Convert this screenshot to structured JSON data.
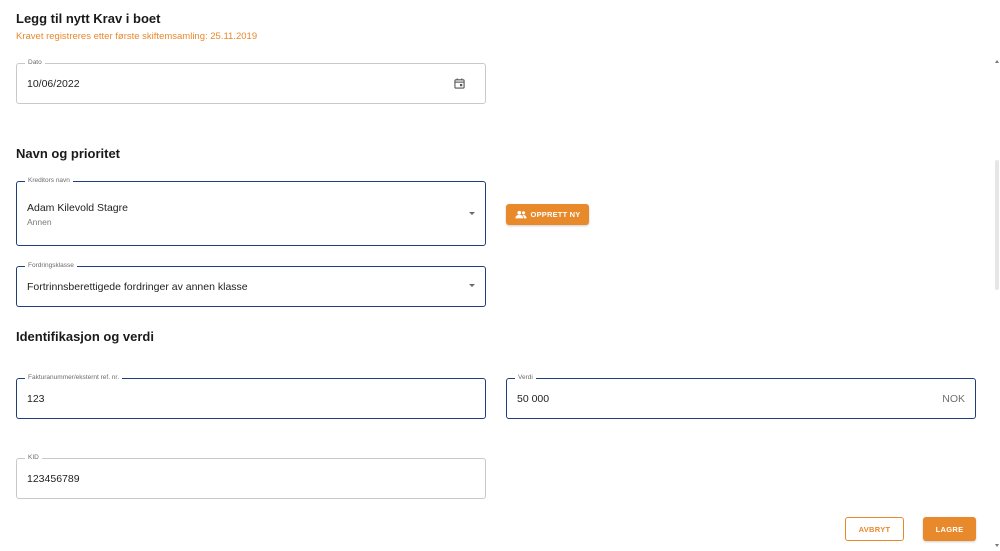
{
  "header": {
    "title": "Legg til nytt Krav i boet",
    "subtitle": "Kravet registreres etter første skiftemsamling: 25.11.2019"
  },
  "dato": {
    "label": "Dato",
    "value": "10/06/2022",
    "icon": "calendar-icon"
  },
  "sections": {
    "navn": "Navn og prioritet",
    "ident": "Identifikasjon og verdi"
  },
  "kreditor": {
    "label": "Kreditors navn",
    "value": "Adam Kilevold Stagre",
    "sub": "Annen"
  },
  "opprett_button": {
    "label": "OPPRETT NY",
    "icon": "people-icon"
  },
  "fordringsklasse": {
    "label": "Fordringsklasse",
    "value": "Fortrinnsberettigede fordringer av annen klasse"
  },
  "faktura": {
    "label": "Fakturanummer/eksternt ref. nr.",
    "value": "123"
  },
  "verdi": {
    "label": "Verdi",
    "value": "50 000",
    "suffix": "NOK"
  },
  "kid": {
    "label": "KID",
    "value": "123456789"
  },
  "actions": {
    "cancel": "AVBRYT",
    "save": "LAGRE"
  },
  "colors": {
    "accent": "#e8892b",
    "focus_border": "#1f3f7a"
  }
}
